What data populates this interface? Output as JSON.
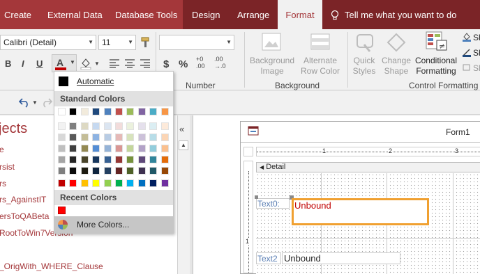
{
  "tabs": {
    "create": "Create",
    "external_data": "External Data",
    "database_tools": "Database Tools",
    "design": "Design",
    "arrange": "Arrange",
    "format": "Format",
    "tell_me": "Tell me what you want to do"
  },
  "ribbon": {
    "font_name": "Calibri (Detail)",
    "font_size": "11",
    "bold": "B",
    "italic": "I",
    "underline": "U",
    "currency": "$",
    "percent": "%",
    "inc_decimal": "+0\n.00",
    "dec_decimal": ".00\n→.0",
    "number_group": "Number",
    "background_image": "Background\nImage",
    "alternate_row_color": "Alternate\nRow Color",
    "background_group": "Background",
    "quick_styles": "Quick\nStyles",
    "change_shape": "Change\nShape",
    "conditional_formatting": "Conditional\nFormatting",
    "control_formatting_group": "Control Formatting",
    "shape_fill": "Sh",
    "shape_outline": "Sh",
    "shape_effects": "Sh"
  },
  "nav": {
    "title": "jects",
    "items": [
      "e",
      "rsist",
      "rs",
      "rs_AgainstIT",
      "ersToQABeta",
      "RootToWin7Version",
      "_OrigWith_WHERE_Clause"
    ]
  },
  "form": {
    "title": "Form1",
    "section": "Detail",
    "text0_label": "Text0:",
    "text0_value": "Unbound",
    "text2_label": "Text2",
    "text2_value": "Unbound",
    "ruler_numbers": [
      "1",
      "2",
      "3"
    ],
    "vruler_numbers": [
      "1"
    ]
  },
  "color_menu": {
    "automatic": "Automatic",
    "standard_colors": "Standard Colors",
    "recent_colors": "Recent Colors",
    "more_colors": "More Colors...",
    "font_color_accent": "#c00000",
    "palette": [
      [
        "#ffffff",
        "#000000",
        "#f2ebdc",
        "#1f497d",
        "#4f81bd",
        "#c0504d",
        "#9bbb59",
        "#8064a2",
        "#4bacc6",
        "#f79646"
      ],
      [
        "#f2f2f2",
        "#7f7f7f",
        "#ddd9c3",
        "#c6d9f0",
        "#dbe5f1",
        "#f2dcdb",
        "#ebf1dd",
        "#e5e0ec",
        "#dbeef3",
        "#fdeada"
      ],
      [
        "#d8d8d8",
        "#595959",
        "#c4bd97",
        "#8db3e2",
        "#b8cce4",
        "#e5b9b7",
        "#d7e3bc",
        "#ccc1d9",
        "#b7dde8",
        "#fbd5b5"
      ],
      [
        "#bfbfbf",
        "#3f3f3f",
        "#938953",
        "#548dd4",
        "#95b3d7",
        "#d99694",
        "#c3d69b",
        "#b2a2c7",
        "#92cddc",
        "#fac08f"
      ],
      [
        "#a5a5a5",
        "#262626",
        "#494429",
        "#17365d",
        "#366092",
        "#953734",
        "#76923c",
        "#5f497a",
        "#31859b",
        "#e36c09"
      ],
      [
        "#7f7f7f",
        "#0c0c0c",
        "#1d1b10",
        "#0f243e",
        "#244061",
        "#632423",
        "#4f6128",
        "#3f3151",
        "#205867",
        "#974806"
      ],
      [
        "#c00000",
        "#ff0000",
        "#ffc000",
        "#ffff00",
        "#92d050",
        "#00b050",
        "#00b0f0",
        "#0070c0",
        "#002060",
        "#7030a0"
      ]
    ],
    "recent": [
      "#ff0000"
    ]
  }
}
